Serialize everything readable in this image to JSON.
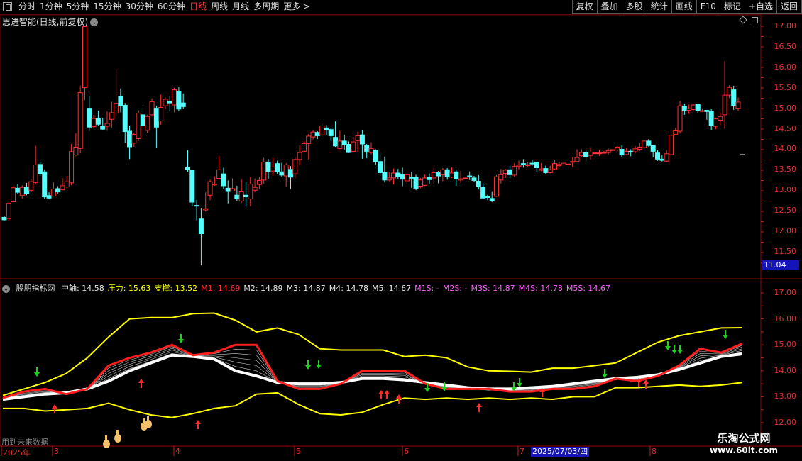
{
  "toolbar": {
    "periods": [
      "分时",
      "1分钟",
      "5分钟",
      "15分钟",
      "30分钟",
      "60分钟",
      "日线",
      "周线",
      "月线",
      "多周期",
      "更多 >"
    ],
    "active_index": 6,
    "right_buttons": [
      "复权",
      "叠加",
      "多股",
      "统计",
      "画线",
      "F10",
      "标记",
      "+自选",
      "返回"
    ]
  },
  "main": {
    "title": "思进智能(日线,前复权)",
    "current_price_tag": "11.04"
  },
  "indicator": {
    "name": "股朋指标网",
    "items": [
      {
        "label": "中轴:",
        "value": "14.58",
        "color": "#e6e6e6"
      },
      {
        "label": "压力:",
        "value": "15.63",
        "color": "#ffff00"
      },
      {
        "label": "支撑:",
        "value": "13.52",
        "color": "#ffff00"
      },
      {
        "label": "M1:",
        "value": "14.69",
        "color": "#ff3030"
      },
      {
        "label": "M2:",
        "value": "14.89",
        "color": "#e6e6e6"
      },
      {
        "label": "M3:",
        "value": "14.87",
        "color": "#e6e6e6"
      },
      {
        "label": "M4:",
        "value": "14.78",
        "color": "#e6e6e6"
      },
      {
        "label": "M5:",
        "value": "14.67",
        "color": "#e6e6e6"
      },
      {
        "label": "M1S:",
        "value": "-",
        "color": "#ff60ff"
      },
      {
        "label": "M2S:",
        "value": "-",
        "color": "#ff60ff"
      },
      {
        "label": "M3S:",
        "value": "14.87",
        "color": "#ff60ff"
      },
      {
        "label": "M4S:",
        "value": "14.78",
        "color": "#ff60ff"
      },
      {
        "label": "M5S:",
        "value": "14.67",
        "color": "#ff60ff"
      }
    ]
  },
  "axis_main": [
    "17.00",
    "16.50",
    "16.00",
    "15.50",
    "15.00",
    "14.50",
    "14.00",
    "13.50",
    "13.00",
    "12.50",
    "12.00",
    "11.50"
  ],
  "axis_sub": [
    "17.00",
    "16.00",
    "15.00",
    "14.00",
    "13.00",
    "12.00"
  ],
  "bottom_note": "用到未来数据",
  "dates": [
    {
      "t": "2025年"
    },
    {
      "t": "3"
    },
    {
      "t": "4"
    },
    {
      "t": "5"
    },
    {
      "t": "6"
    },
    {
      "t": "7"
    },
    {
      "t": "8"
    }
  ],
  "cursor_date": "2025/07/03/四",
  "watermark": {
    "name": "乐淘公式网",
    "url": "www.60lt.com"
  },
  "colors": {
    "up": "#ff3232",
    "down": "#54ffff",
    "axis": "#e03030",
    "support": "#ffff00"
  },
  "candles": [
    [
      12.34,
      12.28,
      12.38,
      12.26
    ],
    [
      12.31,
      12.68,
      12.72,
      12.26
    ],
    [
      12.72,
      13.06,
      13.1,
      12.7
    ],
    [
      13.05,
      12.95,
      13.15,
      12.9
    ],
    [
      12.87,
      13.07,
      13.12,
      12.8
    ],
    [
      13.08,
      12.92,
      13.18,
      12.88
    ],
    [
      13.0,
      13.21,
      13.28,
      12.95
    ],
    [
      13.19,
      13.62,
      14.08,
      13.15
    ],
    [
      13.63,
      13.4,
      13.7,
      13.35
    ],
    [
      13.45,
      12.84,
      13.5,
      12.8
    ],
    [
      12.87,
      12.81,
      12.95,
      12.78
    ],
    [
      12.86,
      13.03,
      13.2,
      12.84
    ],
    [
      13.04,
      12.96,
      13.1,
      12.92
    ],
    [
      13.01,
      13.11,
      13.3,
      13.0
    ],
    [
      13.08,
      13.21,
      13.35,
      13.05
    ],
    [
      13.18,
      13.94,
      14.13,
      13.12
    ],
    [
      13.86,
      14.05,
      14.39,
      13.83
    ],
    [
      14.02,
      15.38,
      15.55,
      13.9
    ],
    [
      15.5,
      16.99,
      17.0,
      15.2
    ],
    [
      15.0,
      14.54,
      15.3,
      14.45
    ],
    [
      14.55,
      14.75,
      14.84,
      14.52
    ],
    [
      14.76,
      14.61,
      14.94,
      14.58
    ],
    [
      14.56,
      14.49,
      14.77,
      14.47
    ],
    [
      14.56,
      14.63,
      14.92,
      14.45
    ],
    [
      14.73,
      14.89,
      15.16,
      14.52
    ],
    [
      14.88,
      15.12,
      15.97,
      14.81
    ],
    [
      15.29,
      15.07,
      15.48,
      14.9
    ],
    [
      15.07,
      14.43,
      15.13,
      14.15
    ],
    [
      14.44,
      14.06,
      14.58,
      13.76
    ],
    [
      14.15,
      14.36,
      14.39,
      14.06
    ],
    [
      14.26,
      14.88,
      14.95,
      14.2
    ],
    [
      14.84,
      14.58,
      15.02,
      14.41
    ],
    [
      14.46,
      14.8,
      14.84,
      14.39
    ],
    [
      14.84,
      15.16,
      15.24,
      14.8
    ],
    [
      15.0,
      14.54,
      15.06,
      14.04
    ],
    [
      14.69,
      15.02,
      15.33,
      14.6
    ],
    [
      15.06,
      15.22,
      15.26,
      14.98
    ],
    [
      15.17,
      15.13,
      15.3,
      14.92
    ],
    [
      15.08,
      15.45,
      15.5,
      14.9
    ],
    [
      15.4,
      14.98,
      15.51,
      14.93
    ],
    [
      15.13,
      15.04,
      15.36,
      14.99
    ],
    [
      13.55,
      13.5,
      13.98,
      13.45
    ],
    [
      13.48,
      12.71,
      13.37,
      12.61
    ],
    [
      12.63,
      12.62,
      12.76,
      12.27
    ],
    [
      12.3,
      11.94,
      12.57,
      11.17
    ],
    [
      12.52,
      12.55,
      12.95,
      12.48
    ],
    [
      12.88,
      13.21,
      13.26,
      12.76
    ],
    [
      13.13,
      13.15,
      13.34,
      13.11
    ],
    [
      13.29,
      13.5,
      13.84,
      13.26
    ],
    [
      13.4,
      13.11,
      13.55,
      13.03
    ],
    [
      13.05,
      12.97,
      13.24,
      12.68
    ],
    [
      12.98,
      13.04,
      13.29,
      12.97
    ],
    [
      12.88,
      12.79,
      13.11,
      12.74
    ],
    [
      12.74,
      12.96,
      13.26,
      12.7
    ],
    [
      12.88,
      12.84,
      13.21,
      12.6
    ],
    [
      12.79,
      13.15,
      13.32,
      12.61
    ],
    [
      13.0,
      13.07,
      13.29,
      12.95
    ],
    [
      13.14,
      13.24,
      13.33,
      13.03
    ],
    [
      13.25,
      13.69,
      13.79,
      13.16
    ],
    [
      13.69,
      13.46,
      13.76,
      13.28
    ],
    [
      13.47,
      13.57,
      13.79,
      13.36
    ],
    [
      13.65,
      13.46,
      13.72,
      13.4
    ],
    [
      13.45,
      13.37,
      13.67,
      13.33
    ],
    [
      13.35,
      13.62,
      13.66,
      13.08
    ],
    [
      13.51,
      13.32,
      13.59,
      13.03
    ],
    [
      13.4,
      13.75,
      13.8,
      13.29
    ],
    [
      13.75,
      13.92,
      14.1,
      13.61
    ],
    [
      13.95,
      14.14,
      14.2,
      13.92
    ],
    [
      14.14,
      14.32,
      14.37,
      13.75
    ],
    [
      14.3,
      14.42,
      14.46,
      14.24
    ],
    [
      14.41,
      14.33,
      14.44,
      14.25
    ],
    [
      14.35,
      14.57,
      14.63,
      14.3
    ],
    [
      14.52,
      14.47,
      14.59,
      14.35
    ],
    [
      14.48,
      14.33,
      14.52,
      14.2
    ],
    [
      14.29,
      14.08,
      14.68,
      14.06
    ],
    [
      14.02,
      14.2,
      14.45,
      14.0
    ],
    [
      14.2,
      14.12,
      14.35,
      13.99
    ],
    [
      14.12,
      13.92,
      14.19,
      13.91
    ],
    [
      13.95,
      14.18,
      14.3,
      13.95
    ],
    [
      14.21,
      14.33,
      14.43,
      13.92
    ],
    [
      14.35,
      14.13,
      14.46,
      13.77
    ],
    [
      14.1,
      13.95,
      14.13,
      13.78
    ],
    [
      13.92,
      14.02,
      14.17,
      13.88
    ],
    [
      13.97,
      13.7,
      14.0,
      13.61
    ],
    [
      13.7,
      13.43,
      13.93,
      13.35
    ],
    [
      13.43,
      13.25,
      13.82,
      13.19
    ],
    [
      13.25,
      13.3,
      13.44,
      13.22
    ],
    [
      13.3,
      13.42,
      13.53,
      13.14
    ],
    [
      13.42,
      13.33,
      13.52,
      13.27
    ],
    [
      13.38,
      13.27,
      13.55,
      13.1
    ],
    [
      13.23,
      13.38,
      13.4,
      13.16
    ],
    [
      13.31,
      13.3,
      13.45,
      13.06
    ],
    [
      13.31,
      13.05,
      13.38,
      13.0
    ],
    [
      13.1,
      13.25,
      13.3,
      13.05
    ],
    [
      13.12,
      13.3,
      13.38,
      13.1
    ],
    [
      13.32,
      13.26,
      13.41,
      13.14
    ],
    [
      13.3,
      13.43,
      13.54,
      13.16
    ],
    [
      13.44,
      13.35,
      13.47,
      13.17
    ],
    [
      13.38,
      13.5,
      13.54,
      13.22
    ],
    [
      13.5,
      13.34,
      13.54,
      13.26
    ],
    [
      13.32,
      13.42,
      13.56,
      13.3
    ],
    [
      13.45,
      13.28,
      13.51,
      13.11
    ],
    [
      13.25,
      13.28,
      13.47,
      13.18
    ],
    [
      13.3,
      13.3,
      13.3,
      13.3
    ],
    [
      13.35,
      13.34,
      13.46,
      13.25
    ],
    [
      13.3,
      13.24,
      13.35,
      13.2
    ],
    [
      13.22,
      13.1,
      13.37,
      13.02
    ],
    [
      13.08,
      12.81,
      13.18,
      12.79
    ],
    [
      12.84,
      12.83,
      12.89,
      12.76
    ],
    [
      12.8,
      12.74,
      12.96,
      12.71
    ],
    [
      12.85,
      13.33,
      13.37,
      12.84
    ],
    [
      13.25,
      13.38,
      13.52,
      13.16
    ],
    [
      13.41,
      13.49,
      13.52,
      13.3
    ],
    [
      13.5,
      13.38,
      13.6,
      13.3
    ],
    [
      13.37,
      13.58,
      13.66,
      13.33
    ],
    [
      13.58,
      13.61,
      13.72,
      13.51
    ],
    [
      13.65,
      13.63,
      13.76,
      13.55
    ],
    [
      13.61,
      13.62,
      13.68,
      13.57
    ],
    [
      13.66,
      13.65,
      13.75,
      13.6
    ],
    [
      13.67,
      13.55,
      13.71,
      13.44
    ],
    [
      13.49,
      13.52,
      13.66,
      13.47
    ],
    [
      13.53,
      13.43,
      13.6,
      13.39
    ],
    [
      13.43,
      13.5,
      13.6,
      13.41
    ],
    [
      13.52,
      13.65,
      13.74,
      13.49
    ],
    [
      13.6,
      13.63,
      13.68,
      13.57
    ],
    [
      13.62,
      13.66,
      13.67,
      13.6
    ],
    [
      13.64,
      13.64,
      13.64,
      13.64
    ],
    [
      13.69,
      13.7,
      13.8,
      13.56
    ],
    [
      13.7,
      13.8,
      14.0,
      13.7
    ],
    [
      13.84,
      13.92,
      14.0,
      13.81
    ],
    [
      13.92,
      13.81,
      13.98,
      13.7
    ],
    [
      13.85,
      13.93,
      14.05,
      13.75
    ],
    [
      13.91,
      13.91,
      13.93,
      13.88
    ],
    [
      13.91,
      13.91,
      13.99,
      13.84
    ],
    [
      13.92,
      13.92,
      13.96,
      13.92
    ],
    [
      13.92,
      13.96,
      14.02,
      13.88
    ],
    [
      13.97,
      13.99,
      14.02,
      13.96
    ],
    [
      13.98,
      14.05,
      14.08,
      13.95
    ],
    [
      14.0,
      13.86,
      14.1,
      13.8
    ],
    [
      13.87,
      13.95,
      14.04,
      13.85
    ],
    [
      13.95,
      13.93,
      14.0,
      13.83
    ],
    [
      13.94,
      14.01,
      14.08,
      13.9
    ],
    [
      14.0,
      14.05,
      14.15,
      13.96
    ],
    [
      14.04,
      14.2,
      14.26,
      14.0
    ],
    [
      14.2,
      14.09,
      14.25,
      14.06
    ],
    [
      14.09,
      13.95,
      14.11,
      13.8
    ],
    [
      13.91,
      13.76,
      13.98,
      13.72
    ],
    [
      13.76,
      13.73,
      13.86,
      13.7
    ],
    [
      13.71,
      13.89,
      13.98,
      13.69
    ],
    [
      13.87,
      14.34,
      14.37,
      13.84
    ],
    [
      14.36,
      14.45,
      14.52,
      14.38
    ],
    [
      14.44,
      15.06,
      15.18,
      14.38
    ],
    [
      15.05,
      14.95,
      15.11,
      14.84
    ],
    [
      14.95,
      14.99,
      15.09,
      14.86
    ],
    [
      14.97,
      15.08,
      15.1,
      14.92
    ],
    [
      15.09,
      14.95,
      15.12,
      14.89
    ],
    [
      14.94,
      14.94,
      15.0,
      14.91
    ],
    [
      14.95,
      14.92,
      14.96,
      14.72
    ],
    [
      14.93,
      14.57,
      14.98,
      14.47
    ],
    [
      14.56,
      14.74,
      14.77,
      14.49
    ],
    [
      14.71,
      14.8,
      14.9,
      14.59
    ],
    [
      14.84,
      15.32,
      16.15,
      14.5
    ],
    [
      15.32,
      15.51,
      15.56,
      15.25
    ],
    [
      15.45,
      15.07,
      15.55,
      14.96
    ],
    [
      15.0,
      15.15,
      15.26,
      14.93
    ]
  ],
  "sub_series": {
    "upper": [
      13.05,
      13.3,
      13.55,
      13.9,
      14.5,
      15.3,
      16.0,
      16.05,
      16.05,
      16.2,
      16.22,
      15.95,
      15.5,
      15.65,
      15.4,
      14.85,
      14.8,
      14.8,
      14.8,
      14.55,
      14.6,
      14.5,
      14.15,
      14.0,
      13.98,
      13.95,
      14.1,
      14.1,
      14.2,
      14.3,
      14.7,
      15.1,
      15.35,
      15.5,
      15.65,
      15.66
    ],
    "lower": [
      12.55,
      12.55,
      12.45,
      12.5,
      12.55,
      12.75,
      12.5,
      12.3,
      12.2,
      12.35,
      12.55,
      12.65,
      13.1,
      13.15,
      12.7,
      12.35,
      12.3,
      12.4,
      12.7,
      12.95,
      12.9,
      12.95,
      12.9,
      12.95,
      12.9,
      12.95,
      12.9,
      13.0,
      13.0,
      13.35,
      13.35,
      13.4,
      13.45,
      13.4,
      13.45,
      13.55
    ],
    "red": [
      12.95,
      13.2,
      13.3,
      13.1,
      13.3,
      14.2,
      14.5,
      14.7,
      15.0,
      14.6,
      14.7,
      15.0,
      15.0,
      13.6,
      13.3,
      13.3,
      13.5,
      14.0,
      14.0,
      14.0,
      13.5,
      13.3,
      13.3,
      13.3,
      13.2,
      13.2,
      13.3,
      13.3,
      13.4,
      13.7,
      13.6,
      13.8,
      14.2,
      14.85,
      14.7,
      15.05
    ],
    "white": [
      12.9,
      13.0,
      13.1,
      13.15,
      13.3,
      13.6,
      14.0,
      14.3,
      14.6,
      14.55,
      14.45,
      14.0,
      13.8,
      13.55,
      13.5,
      13.5,
      13.55,
      13.7,
      13.7,
      13.65,
      13.55,
      13.45,
      13.35,
      13.3,
      13.3,
      13.35,
      13.4,
      13.5,
      13.6,
      13.7,
      13.75,
      13.85,
      14.05,
      14.3,
      14.55,
      14.65
    ]
  }
}
